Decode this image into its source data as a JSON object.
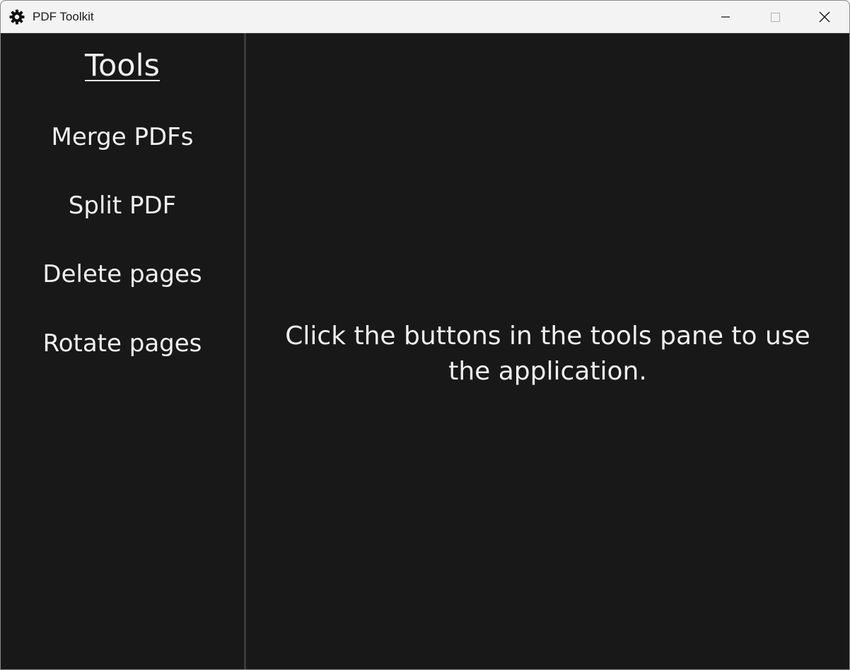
{
  "window": {
    "title": "PDF Toolkit",
    "icon": "gear-icon",
    "controls": {
      "minimize": "minimize-icon",
      "maximize": "maximize-icon",
      "close": "close-icon"
    }
  },
  "sidebar": {
    "heading": "Tools",
    "items": [
      {
        "label": "Merge PDFs"
      },
      {
        "label": "Split PDF"
      },
      {
        "label": "Delete pages"
      },
      {
        "label": "Rotate pages"
      }
    ]
  },
  "main": {
    "message": "Click the buttons in the tools pane to use the application."
  },
  "colors": {
    "background": "#181818",
    "text": "#f0f0f0",
    "divider": "#3a3a3a",
    "titlebar": "#f3f3f3"
  }
}
